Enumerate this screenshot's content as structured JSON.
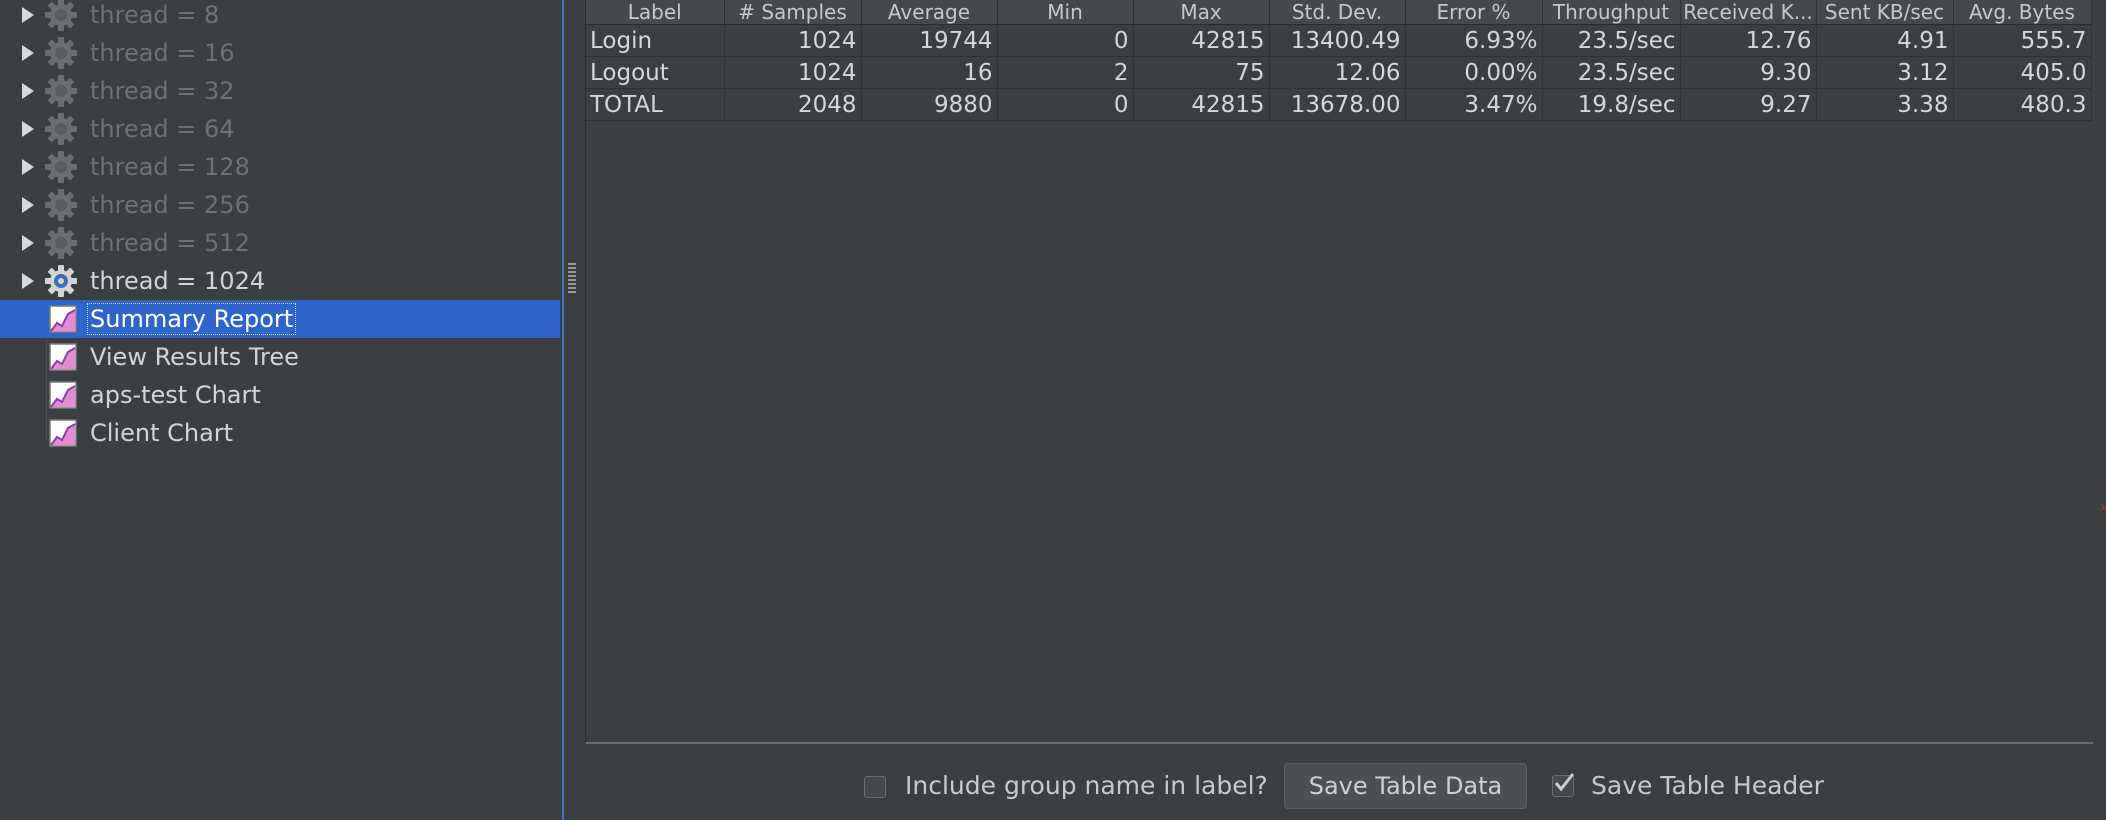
{
  "tree": {
    "items": [
      {
        "label": "thread = 8",
        "icon": "gear-icon",
        "state": "disabled"
      },
      {
        "label": "thread = 16",
        "icon": "gear-icon",
        "state": "disabled"
      },
      {
        "label": "thread = 32",
        "icon": "gear-icon",
        "state": "disabled"
      },
      {
        "label": "thread = 64",
        "icon": "gear-icon",
        "state": "disabled"
      },
      {
        "label": "thread = 128",
        "icon": "gear-icon",
        "state": "disabled"
      },
      {
        "label": "thread = 256",
        "icon": "gear-icon",
        "state": "disabled"
      },
      {
        "label": "thread = 512",
        "icon": "gear-icon",
        "state": "disabled"
      },
      {
        "label": "thread = 1024",
        "icon": "gear-icon",
        "state": "enabled"
      },
      {
        "label": "Summary Report",
        "icon": "chart-icon",
        "state": "selected"
      },
      {
        "label": "View Results Tree",
        "icon": "chart-icon",
        "state": "enabled"
      },
      {
        "label": "aps-test Chart",
        "icon": "chart-icon",
        "state": "enabled"
      },
      {
        "label": "Client Chart",
        "icon": "chart-icon",
        "state": "enabled"
      }
    ]
  },
  "table": {
    "columns": [
      "Label",
      "# Samples",
      "Average",
      "Min",
      "Max",
      "Std. Dev.",
      "Error %",
      "Throughput",
      "Received K...",
      "Sent KB/sec",
      "Avg. Bytes"
    ],
    "rows": [
      [
        "Login",
        "1024",
        "19744",
        "0",
        "42815",
        "13400.49",
        "6.93%",
        "23.5/sec",
        "12.76",
        "4.91",
        "555.7"
      ],
      [
        "Logout",
        "1024",
        "16",
        "2",
        "75",
        "12.06",
        "0.00%",
        "23.5/sec",
        "9.30",
        "3.12",
        "405.0"
      ],
      [
        "TOTAL",
        "2048",
        "9880",
        "0",
        "42815",
        "13678.00",
        "3.47%",
        "19.8/sec",
        "9.27",
        "3.38",
        "480.3"
      ]
    ]
  },
  "bottom": {
    "include_group_label": "Include group name in label?",
    "include_group_checked": false,
    "save_data_label": "Save Table Data",
    "save_header_label": "Save Table Header",
    "save_header_checked": true
  },
  "colors": {
    "background": "#3c3f41",
    "selection": "#2f65ca",
    "splitter_accent": "#3d78c4"
  }
}
